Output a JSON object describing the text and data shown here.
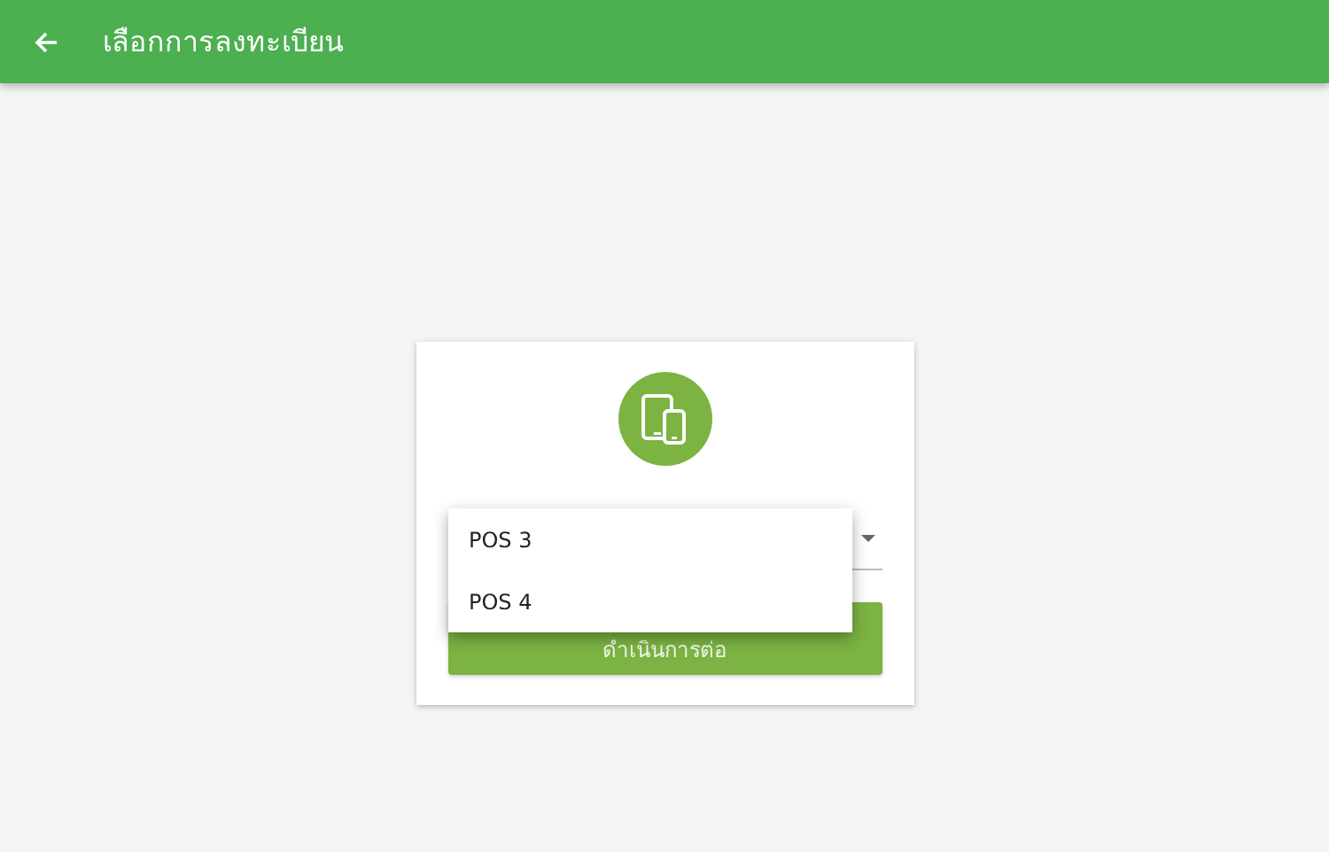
{
  "app_bar": {
    "title": "เลือกการลงทะเบียน"
  },
  "dropdown_menu": {
    "items": [
      {
        "label": "POS 3",
        "selected": false
      },
      {
        "label": "POS 4",
        "selected": false
      }
    ]
  },
  "continue_button": {
    "label": "ดำเนินการต่อ",
    "disabled": true
  }
}
